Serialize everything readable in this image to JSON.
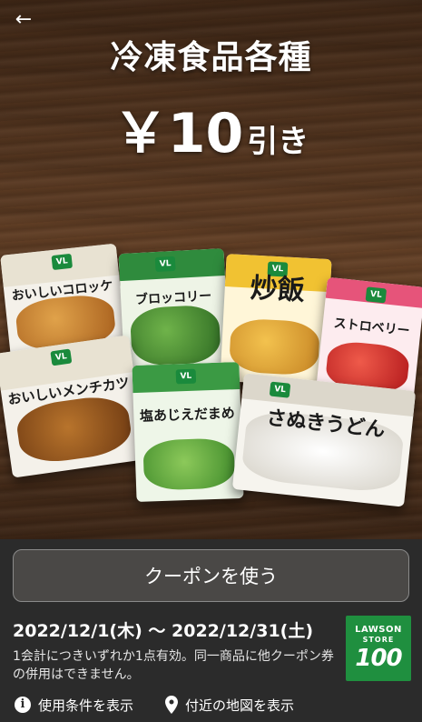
{
  "header": {
    "back_icon": "arrow-left-icon",
    "title": "冷凍食品各種",
    "discount_amount": "￥10",
    "discount_suffix": "引き"
  },
  "products": [
    {
      "name": "おいしいコロッケ",
      "badge": "VL"
    },
    {
      "name": "おいしいメンチカツ",
      "badge": "VL"
    },
    {
      "name": "ブロッコリー",
      "badge": "VL"
    },
    {
      "name": "塩あじえだまめ",
      "badge": "VL"
    },
    {
      "name": "炒飯",
      "badge": "VL"
    },
    {
      "name": "ストロベリー",
      "badge": "VL"
    },
    {
      "name": "さぬきうどん",
      "badge": "VL"
    }
  ],
  "coupon": {
    "button_label": "クーポンを使う",
    "period": "2022/12/1(木) 〜 2022/12/31(土)",
    "note": "1会計につきいずれか1点有効。同一商品に他クーポン券の併用はできません。"
  },
  "logo": {
    "line1": "LAWSON",
    "line2": "STORE",
    "line3": "100",
    "color": "#1f8f3f"
  },
  "links": {
    "terms": {
      "icon": "info-icon",
      "label": "使用条件を表示"
    },
    "map": {
      "icon": "map-pin-icon",
      "label": "付近の地図を表示"
    }
  }
}
